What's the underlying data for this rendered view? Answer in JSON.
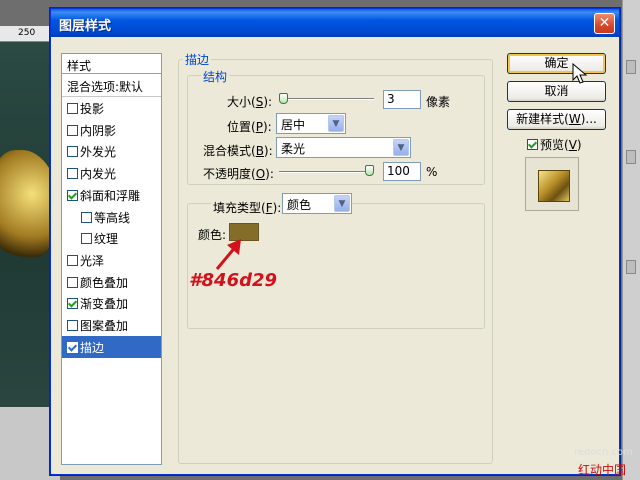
{
  "background": {
    "ruler_tick": "250"
  },
  "dialog": {
    "title": "图层样式",
    "close_glyph": "✕",
    "style_list": {
      "header": "样式",
      "blend_options": "混合选项:默认",
      "items": [
        {
          "label": "投影",
          "checked": false,
          "indent": false,
          "has_checkbox": true
        },
        {
          "label": "内阴影",
          "checked": false,
          "indent": false,
          "has_checkbox": true
        },
        {
          "label": "外发光",
          "checked": false,
          "indent": false,
          "has_checkbox": true
        },
        {
          "label": "内发光",
          "checked": false,
          "indent": false,
          "has_checkbox": true
        },
        {
          "label": "斜面和浮雕",
          "checked": true,
          "indent": false,
          "has_checkbox": true
        },
        {
          "label": "等高线",
          "checked": false,
          "indent": true,
          "has_checkbox": true
        },
        {
          "label": "纹理",
          "checked": false,
          "indent": true,
          "has_checkbox": true
        },
        {
          "label": "光泽",
          "checked": false,
          "indent": false,
          "has_checkbox": true
        },
        {
          "label": "颜色叠加",
          "checked": false,
          "indent": false,
          "has_checkbox": true
        },
        {
          "label": "渐变叠加",
          "checked": true,
          "indent": false,
          "has_checkbox": true
        },
        {
          "label": "图案叠加",
          "checked": false,
          "indent": false,
          "has_checkbox": true
        },
        {
          "label": "描边",
          "checked": true,
          "indent": false,
          "has_checkbox": true,
          "selected": true
        }
      ]
    },
    "stroke": {
      "group_title": "描边",
      "structure_title": "结构",
      "size": {
        "label_pre": "大小(",
        "key": "S",
        "label_post": "):",
        "value": "3",
        "unit": "像素",
        "slider_fraction": 0.0
      },
      "position": {
        "label_pre": "位置(",
        "key": "P",
        "label_post": "):",
        "value": "居中"
      },
      "blend_mode": {
        "label_pre": "混合模式(",
        "key": "B",
        "label_post": "):",
        "value": "柔光"
      },
      "opacity": {
        "label_pre": "不透明度(",
        "key": "O",
        "label_post": "):",
        "value": "100",
        "unit": "%",
        "slider_fraction": 1.0
      },
      "fill_type": {
        "label_pre": "填充类型(",
        "key": "F",
        "label_post": "):",
        "value": "颜色"
      },
      "color_label": "颜色:",
      "color_value": "#846d29"
    },
    "annotation": "#846d29",
    "buttons": {
      "ok": "确定",
      "cancel": "取消",
      "new_style_pre": "新建样式(",
      "new_style_key": "W",
      "new_style_post": ")...",
      "preview_pre": "预览(",
      "preview_key": "V",
      "preview_post": ")",
      "preview_checked": true
    }
  },
  "watermark": {
    "site": "redocn.com",
    "brand": "红动中国"
  }
}
